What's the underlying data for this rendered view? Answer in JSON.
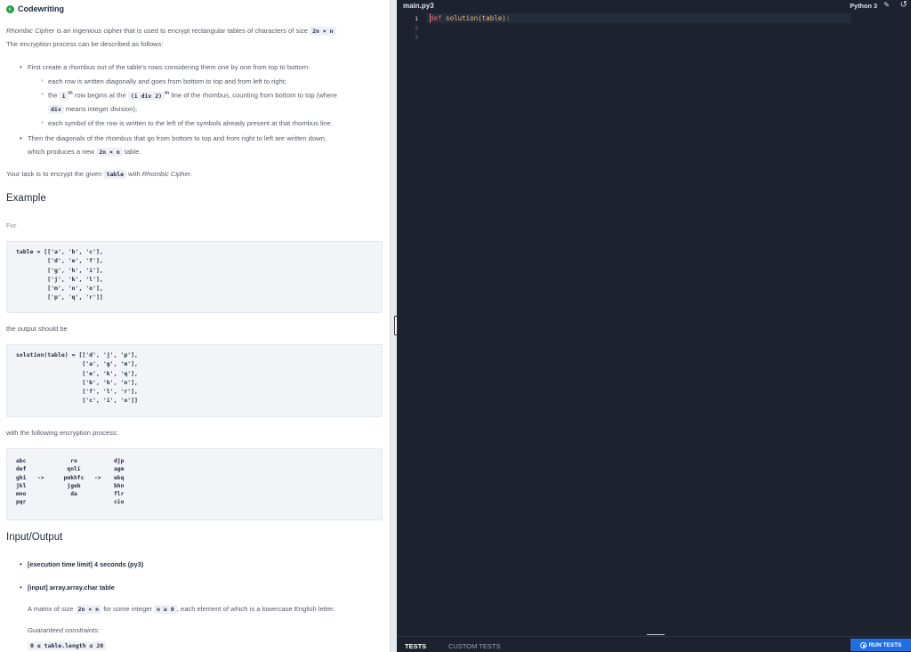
{
  "brand": {
    "name": "Codewriting"
  },
  "description": {
    "intro_italic": "Rhombic Cipher",
    "intro_rest": " is an ingenious cipher that is used to encrypt rectangular tables of characters of size ",
    "size_code": "2n × n",
    "line2": "The encryption process can be described as follows:",
    "b1": "First create a rhombus out of the table's rows considering them one by one from top to bottom:",
    "s1": "each row is written diagonally and goes from bottom to top and from left to right;",
    "s2_a": "the ",
    "s2_code1": "i",
    "s2_sup1": "th",
    "s2_b": " row begins at the ",
    "s2_code2": "(i div 2)",
    "s2_sup2": "th",
    "s2_c": " line of the rhombus, counting from bottom to top (where",
    "s2_code3": "div",
    "s2_d": " means integer division);",
    "s3": "each symbol of the row is written to the left of the symbols already present at that rhombus line.",
    "b2": "Then the diagonals of the rhombus that go from bottom to top and from right to left are written down,",
    "b2_cont_a": "which produces a new ",
    "b2_code": "2n × n",
    "b2_cont_b": " table.",
    "task_a": "Your task is to encrypt the given ",
    "task_code": "table",
    "task_b": " with ",
    "task_italic": "Rhombic Cipher",
    "task_c": "."
  },
  "example": {
    "heading": "Example",
    "for": "For",
    "input_block": "table = [['a', 'b', 'c'],\n         ['d', 'e', 'f'],\n         ['g', 'h', 'i'],\n         ['j', 'k', 'l'],\n         ['m', 'n', 'o'],\n         ['p', 'q', 'r']]",
    "output_label": "the output should be",
    "output_block": "solution(table) = [['d', 'j', 'p'],\n                   ['a', 'g', 'm'],\n                   ['e', 'k', 'q'],\n                   ['b', 'h', 'n'],\n                   ['f', 'l', 'r'],\n                   ['c', 'i', 'o']]",
    "process_label": "with the following encryption process:",
    "process_col1": "abc\ndef\nghi\njkl\nmno\npqr",
    "process_arrows1": "\n\n->\n\n\n",
    "process_col2": "ro\nqnli\npmkhfc\njgeb\nda\n ",
    "process_arrows2": "\n\n->\n\n\n",
    "process_col3": "djp\nagm\nekq\nbhn\nflr\ncio"
  },
  "io": {
    "heading": "Input/Output",
    "item1": "[execution time limit] 4 seconds (py3)",
    "item2": "[input] array.array.char table",
    "matrix_a": "A matrix of size ",
    "matrix_code1": "2n × n",
    "matrix_b": " for some integer ",
    "matrix_code2": "n ≥ 0",
    "matrix_c": ", each element of which is a lowercase English letter.",
    "guaranteed": "Guaranteed constraints:",
    "constraint": "0 ≤ table.length ≤ 20"
  },
  "editor": {
    "file_name": "main.py3",
    "language": "Python 3",
    "line_numbers": [
      "1",
      "2",
      "3"
    ],
    "code_keyword": "def",
    "code_rest": " solution(table):"
  },
  "bottom": {
    "tests_tab": "TESTS",
    "custom_tests_tab": "CUSTOM TESTS",
    "run_button": "RUN TESTS"
  }
}
